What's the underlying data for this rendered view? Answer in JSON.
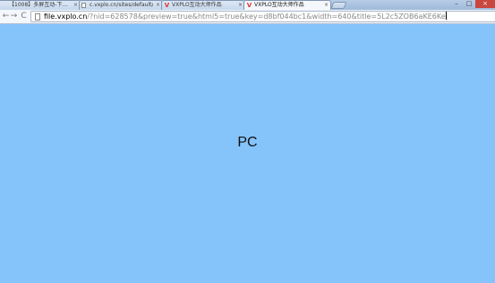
{
  "tabs": [
    {
      "label": "【1008】多屏互动-下…",
      "favicon": "page-icon"
    },
    {
      "label": "c.vxplo.cn/sites/default/…",
      "favicon": "page-icon"
    },
    {
      "label": "VXPLO互动大师作品",
      "favicon": "vxplo-icon"
    },
    {
      "label": "VXPLO互动大师作品",
      "favicon": "vxplo-icon",
      "active": true
    }
  ],
  "tab_close_glyph": "×",
  "brand_glyph": "V",
  "window_controls": {
    "minimize": "–",
    "maximize": "□",
    "close": "×"
  },
  "nav": {
    "back": "←",
    "forward": "→",
    "reload": "C"
  },
  "address": {
    "host": "file.vxplo.cn",
    "path": "/?nid=628578&preview=true&html5=true&key=d8bf044bc1&width=640&title=5L2c5ZOB6aKE6Ke"
  },
  "page": {
    "content_label": "PC"
  }
}
